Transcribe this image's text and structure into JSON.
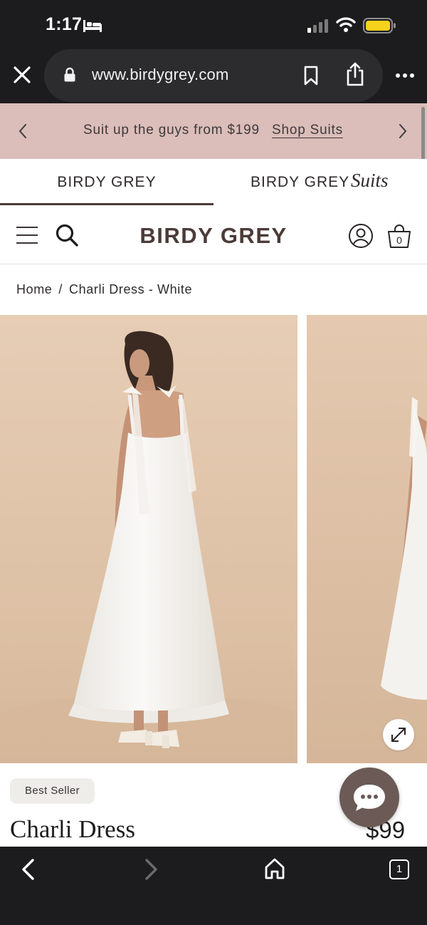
{
  "status_bar": {
    "time": "1:17",
    "icons": [
      "bed-icon",
      "cellular-signal-icon",
      "wifi-icon",
      "battery-icon"
    ]
  },
  "browser": {
    "url": "www.birdygrey.com",
    "icons": [
      "close-icon",
      "lock-icon",
      "bookmark-icon",
      "share-icon",
      "more-icon"
    ]
  },
  "promo": {
    "text": "Suit up the guys from $199",
    "link": "Shop Suits",
    "background": "#dbbdba"
  },
  "brand_tabs": {
    "main": "BIRDY GREY",
    "suits_prefix": "BIRDY GREY",
    "suits_script": "Suits",
    "active": "main"
  },
  "header": {
    "logo": "BIRDY GREY",
    "cart_count": "0",
    "logo_color": "#4b3b37"
  },
  "breadcrumb": {
    "home": "Home",
    "separator": "/",
    "current": "Charli Dress - White"
  },
  "product": {
    "badge": "Best Seller",
    "title": "Charli Dress",
    "price": "$99"
  },
  "toolbar": {
    "tab_count": "1"
  }
}
